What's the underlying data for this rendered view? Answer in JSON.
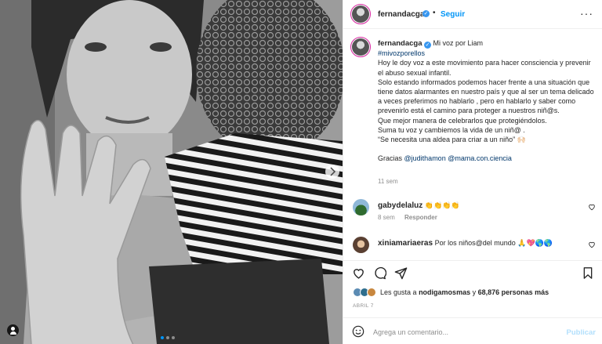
{
  "post": {
    "image_alt": "Black and white photo of a woman holding a child while raising her open hand",
    "carousel_dots": 3,
    "carousel_active": 0
  },
  "header": {
    "username": "fernandacga",
    "verified_glyph": "✓",
    "separator": "•",
    "follow_label": "Seguir",
    "more_glyph": "···"
  },
  "caption": {
    "username": "fernandacga",
    "verified_glyph": "✓",
    "title": "Mi voz por Liam",
    "hashtag": "#mivozporellos",
    "lines": [
      "Hoy le doy voz a este movimiento para hacer consciencia y prevenir el abuso sexual infantil.",
      "Solo estando informados podemos hacer frente a una situación que tiene datos alarmantes en nuestro país y que al ser un tema delicado a veces preferimos no hablarlo , pero en hablarlo y saber como prevenirlo está el camino para proteger a nuestros niñ@s.",
      "Que mejor manera de celebrarlos que protegiéndolos.",
      "Suma tu voz y cambiemos la vida de un niñ@ .",
      "“Se necesita una aldea para criar a un niño” 🙌🏻",
      "",
      ""
    ],
    "thanks_prefix": "Gracias",
    "mention_1": "@judithamon",
    "mention_2": "@mama.con.ciencia",
    "time": "11 sem"
  },
  "comments": [
    {
      "username": "gabydelaluz",
      "text": "👏👏👏👏",
      "time": "8 sem",
      "reply_label": "Responder"
    },
    {
      "username": "xiniamariaeras",
      "text": "Por los niños@del mundo 🙏💖🌎🌎"
    }
  ],
  "likes": {
    "prefix": "Les gusta a",
    "first_user": "nodigamosmas",
    "middle": "y",
    "count": "68,876 personas más"
  },
  "date": "ABRIL 7",
  "add_comment": {
    "placeholder": "Agrega un comentario...",
    "post_label": "Publicar"
  },
  "icons": {
    "like": "heart-icon",
    "comment": "comment-icon",
    "share": "share-icon",
    "save": "bookmark-icon",
    "emoji": "emoji-icon",
    "tag": "user-tag-icon"
  },
  "colors": {
    "link_blue": "#0095f6",
    "mention": "#00376b",
    "muted": "#8e8e8e",
    "border": "#efefef",
    "verified": "#3897f0"
  }
}
